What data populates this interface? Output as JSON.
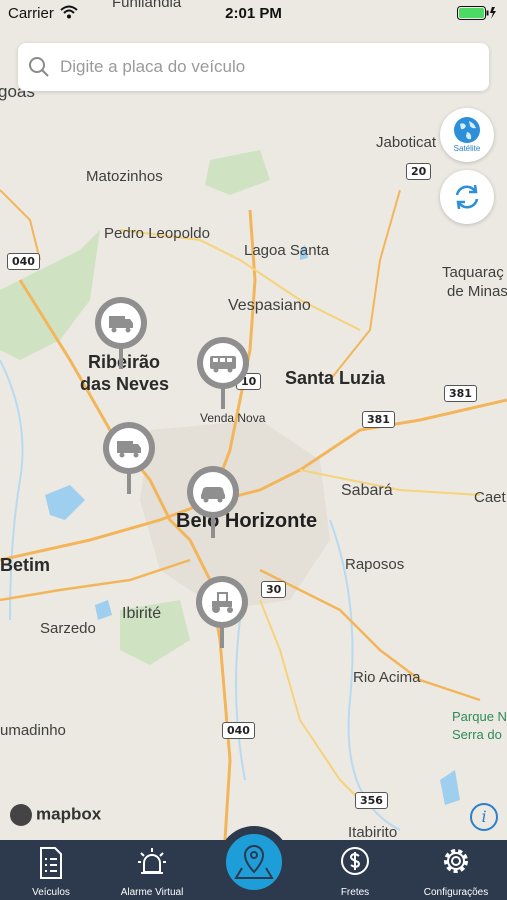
{
  "status_bar": {
    "carrier": "Carrier",
    "time": "2:01 PM"
  },
  "search": {
    "placeholder": "Digite a placa do veículo"
  },
  "fabs": {
    "satellite_label": "Satélite"
  },
  "map": {
    "places": [
      {
        "name": "Funilândia",
        "kind": "normal"
      },
      {
        "name": "goas",
        "kind": "normal"
      },
      {
        "name": "Jaboticat",
        "kind": "normal"
      },
      {
        "name": "Matozinhos",
        "kind": "normal"
      },
      {
        "name": "Pedro Leopoldo",
        "kind": "normal"
      },
      {
        "name": "Lagoa Santa",
        "kind": "normal"
      },
      {
        "name": "Taquaraç",
        "kind": "normal"
      },
      {
        "name": "de Minas",
        "kind": "normal"
      },
      {
        "name": "Vespasiano",
        "kind": "normal"
      },
      {
        "name": "Ribeirão",
        "kind": "big"
      },
      {
        "name": "das Neves",
        "kind": "big"
      },
      {
        "name": "Venda Nova",
        "kind": "small"
      },
      {
        "name": "Santa Luzia",
        "kind": "big"
      },
      {
        "name": "Sabará",
        "kind": "normal"
      },
      {
        "name": "Caet",
        "kind": "normal"
      },
      {
        "name": "Belo Horizonte",
        "kind": "city"
      },
      {
        "name": "Betim",
        "kind": "big"
      },
      {
        "name": "Raposos",
        "kind": "normal"
      },
      {
        "name": "Ibirité",
        "kind": "normal"
      },
      {
        "name": "Sarzedo",
        "kind": "normal"
      },
      {
        "name": "Rio Acima",
        "kind": "normal"
      },
      {
        "name": "Parque N",
        "kind": "park"
      },
      {
        "name": "Serra do",
        "kind": "park"
      },
      {
        "name": "umadinho",
        "kind": "normal"
      },
      {
        "name": "Itabirito",
        "kind": "normal"
      }
    ],
    "shields": [
      "040",
      "20",
      "10",
      "381",
      "381",
      "30",
      "040",
      "356"
    ],
    "vehicles": [
      {
        "type": "truck"
      },
      {
        "type": "bus"
      },
      {
        "type": "truck"
      },
      {
        "type": "car"
      },
      {
        "type": "tractor"
      }
    ]
  },
  "attribution": {
    "brand": "mapbox",
    "info": "i"
  },
  "tabs": [
    {
      "label": "Veículos",
      "icon": "document-list-icon"
    },
    {
      "label": "Alarme Virtual",
      "icon": "alarm-light-icon"
    },
    {
      "label": "",
      "icon": "map-pin-icon"
    },
    {
      "label": "Fretes",
      "icon": "dollar-icon"
    },
    {
      "label": "Configurações",
      "icon": "gear-icon"
    }
  ]
}
